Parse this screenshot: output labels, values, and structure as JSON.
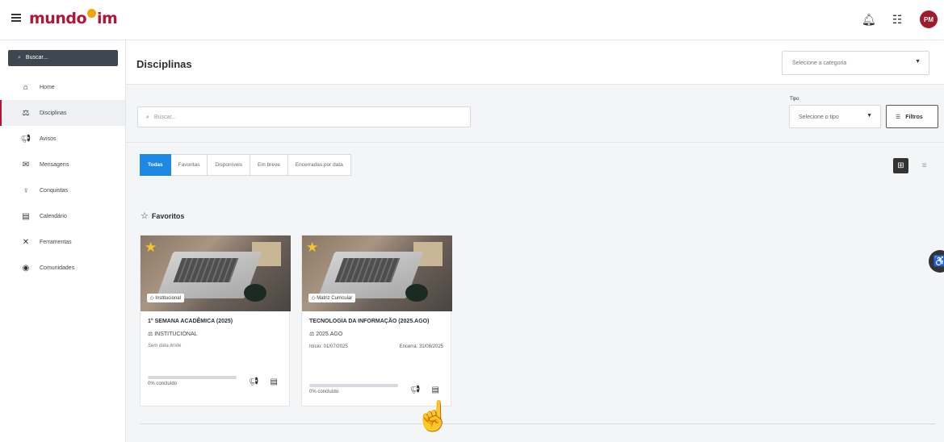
{
  "app": {
    "logo_text_left": "mundo",
    "logo_text_right": "im",
    "avatar_initials": "PM",
    "brand_color": "#b0153a",
    "accent_color": "#1e88e5",
    "icons": [
      "menu-icon",
      "bell-icon",
      "apps-grid-icon"
    ]
  },
  "sidebar": {
    "search_label": "Buscar...",
    "items": [
      {
        "label": "Home",
        "icon": "home-icon"
      },
      {
        "label": "Disciplinas",
        "icon": "graduation-cap-icon",
        "active": true
      },
      {
        "label": "Avisos",
        "icon": "megaphone-icon"
      },
      {
        "label": "Mensagens",
        "icon": "mail-icon"
      },
      {
        "label": "Conquistas",
        "icon": "medal-icon"
      },
      {
        "label": "Calendário",
        "icon": "calendar-icon"
      },
      {
        "label": "Ferramentas",
        "icon": "tools-icon"
      },
      {
        "label": "Comunidades",
        "icon": "community-icon"
      }
    ]
  },
  "header": {
    "title": "Disciplinas",
    "category_placeholder": "Selecione a categoria"
  },
  "filters": {
    "search_placeholder": "Buscar...",
    "tipo_label": "Tipo",
    "tipo_placeholder": "Selecione o tipo",
    "filtros_label": "Filtros"
  },
  "tabs": [
    "Todas",
    "Favoritas",
    "Disponíveis",
    "Em breve",
    "Encerradas por data"
  ],
  "active_tab": "Todas",
  "favorites": {
    "heading": "Favoritos",
    "cards": [
      {
        "tag": "Institucional",
        "title": "1° SEMANA ACADÊMICA (2025)",
        "category": "INSTITUCIONAL",
        "meta": "Sem data limite",
        "progress": 0,
        "progress_text": "0% concluído"
      },
      {
        "tag": "Matriz Curricular",
        "title": "TECNOLOGIA DA INFORMAÇÃO (2025.AGO)",
        "category": "2025.AGO",
        "start": "Início: 01/07/2025",
        "end": "Encerra: 31/08/2025",
        "progress": 0,
        "progress_text": "0% concluído"
      }
    ]
  }
}
